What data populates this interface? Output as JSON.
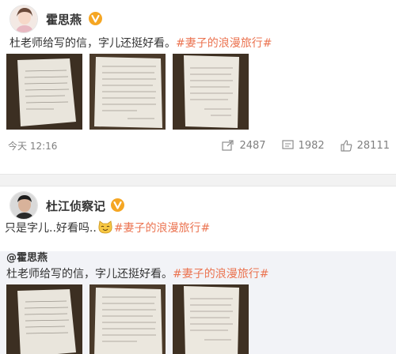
{
  "post1": {
    "username": "霍思燕",
    "text_plain": "杜老师给写的信，字儿还挺好看。",
    "topic": "#妻子的浪漫旅行#",
    "timestamp": "今天 12:16",
    "stats": {
      "reposts": "2487",
      "comments": "1982",
      "likes": "28111"
    }
  },
  "post2": {
    "username": "杜江侦察记",
    "text_plain": "只是字儿..好看吗..",
    "emoji": "cat-face-emoji",
    "topic": "#妻子的浪漫旅行#",
    "retweet": {
      "author": "@霍思燕",
      "text_plain": "杜老师给写的信，字儿还挺好看。",
      "topic": "#妻子的浪漫旅行#"
    }
  },
  "colors": {
    "topic": "#eb7350",
    "verified_badge": "#f5a623",
    "meta_text": "#808080",
    "repost_bg": "#f2f3f7"
  }
}
